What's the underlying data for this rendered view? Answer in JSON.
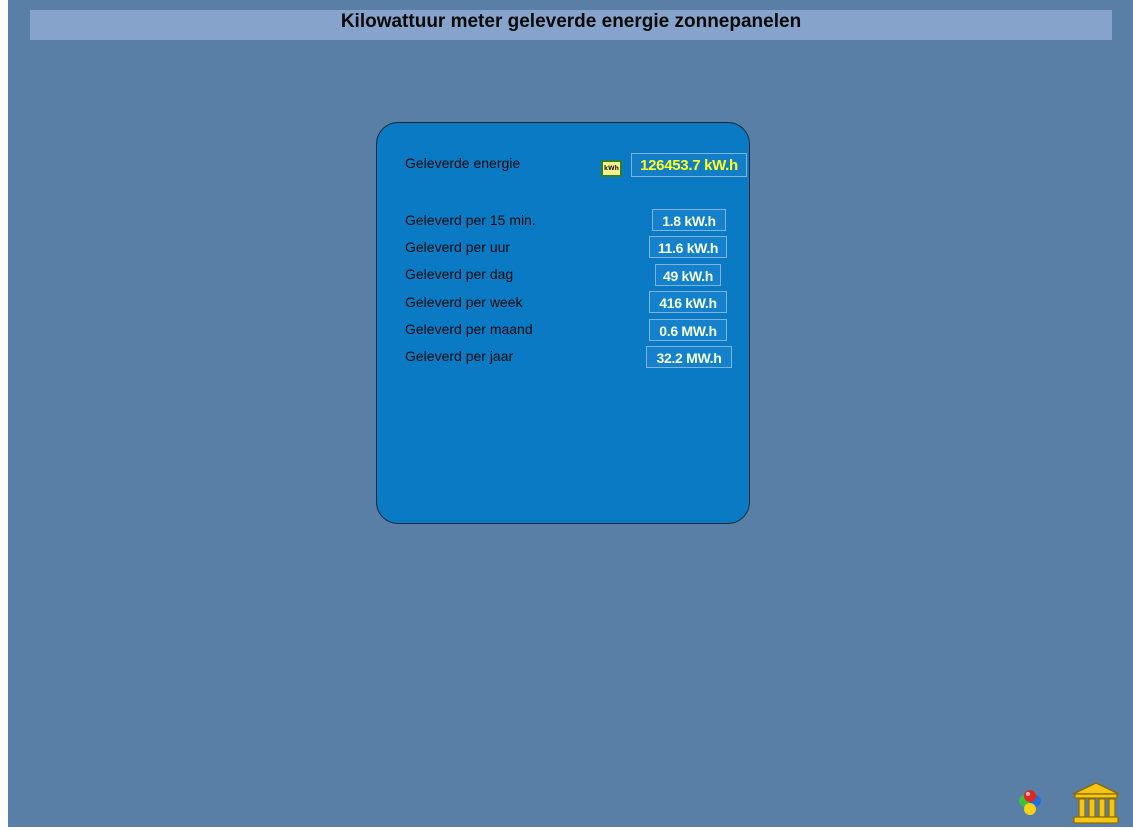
{
  "header": {
    "title": "Kilowattuur meter geleverde energie zonnepanelen"
  },
  "panel": {
    "total": {
      "label": "Geleverde energie",
      "icon": "kwh-meter-icon",
      "icon_text": "kWh",
      "value": "126453.7 kW.h"
    },
    "rows": [
      {
        "label": "Geleverd per 15 min.",
        "value": "1.8 kW.h"
      },
      {
        "label": "Geleverd per uur",
        "value": "11.6 kW.h"
      },
      {
        "label": "Geleverd per dag",
        "value": "49 kW.h"
      },
      {
        "label": "Geleverd per week",
        "value": "416 kW.h"
      },
      {
        "label": "Geleverd per maand",
        "value": "0.6 MW.h"
      },
      {
        "label": "Geleverd per jaar",
        "value": "32.2 MW.h"
      }
    ]
  },
  "footer": {
    "icons": [
      "color-balls-icon",
      "home-building-icon"
    ]
  },
  "colors": {
    "background": "#5a7fa6",
    "title_bar": "#86a3cc",
    "panel": "#0a7ac4",
    "total_value_text": "#ffff20",
    "value_text": "#f4ffe6",
    "home_icon": "#f5c518"
  }
}
